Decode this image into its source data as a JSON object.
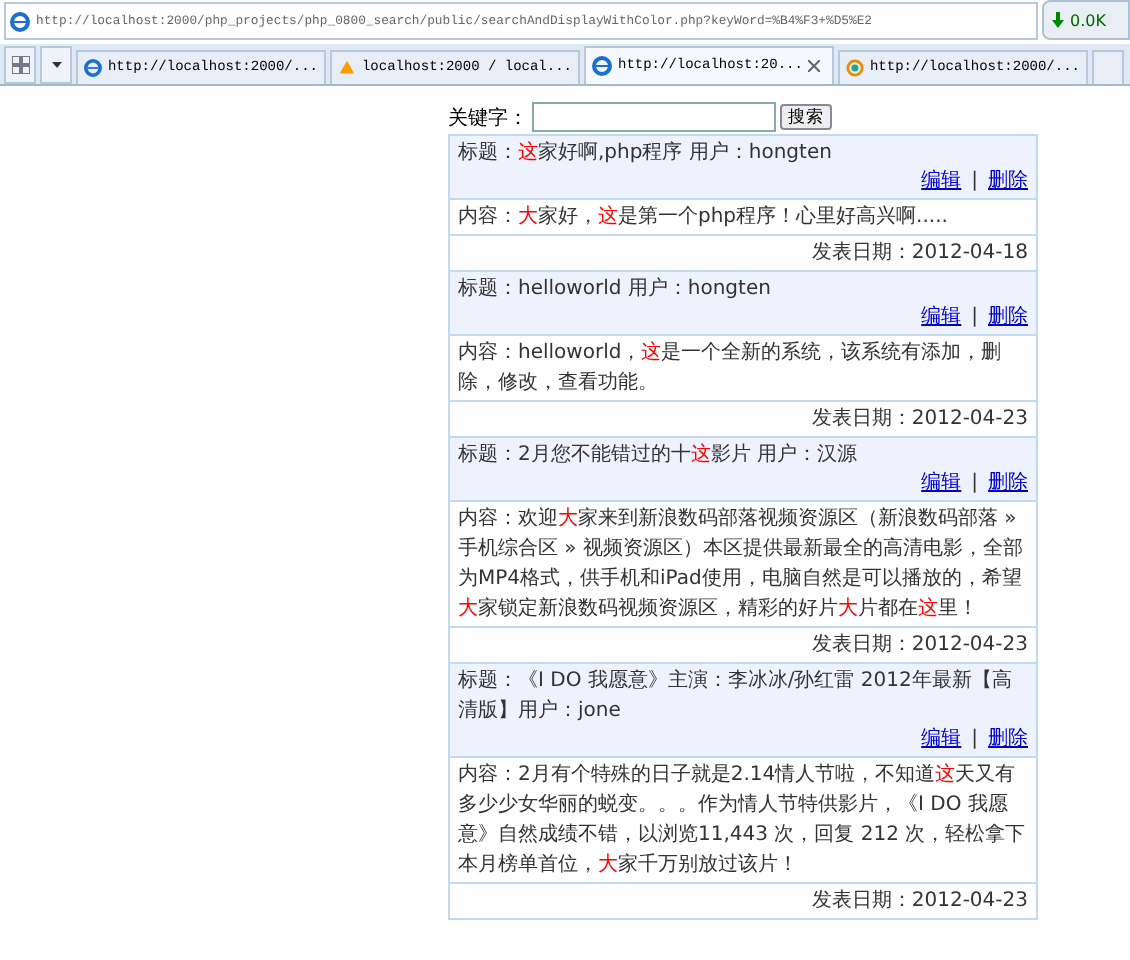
{
  "address_bar": {
    "url": "http://localhost:2000/php_projects/php_0800_search/public/searchAndDisplayWithColor.php?keyWord=%B4%F3+%D5%E2"
  },
  "net_widget": {
    "reading": "0.0K"
  },
  "tabs": [
    {
      "label": "http://localhost:2000/...",
      "selected": false
    },
    {
      "label": "localhost:2000 / local...",
      "selected": false
    },
    {
      "label": "http://localhost:20...",
      "selected": true
    },
    {
      "label": "http://localhost:2000/...",
      "selected": false
    }
  ],
  "search": {
    "label": "关键字：",
    "button": "搜索"
  },
  "posts": [
    {
      "title": "标题：**这**家好啊,php程序 用户：hongten",
      "edit": "编辑",
      "separator": "|",
      "delete": "删除",
      "content": "内容：**大**家好，**这**是第一个php程序！心里好高兴啊.....",
      "date": "发表日期：2012-04-18"
    },
    {
      "title": "标题：helloworld 用户：hongten",
      "edit": "编辑",
      "separator": "|",
      "delete": "删除",
      "content": "内容：helloworld，**这**是一个全新的系统，该系统有添加，删除，修改，查看功能。",
      "date": "发表日期：2012-04-23"
    },
    {
      "title": "标题：2月您不能错过的十**这**影片 用户：汉源",
      "edit": "编辑",
      "separator": "|",
      "delete": "删除",
      "content": "内容：欢迎**大**家来到新浪数码部落视频资源区（新浪数码部落 » 手机综合区 » 视频资源区）本区提供最新最全的高清电影，全部为MP4格式，供手机和iPad使用，电脑自然是可以播放的，希望**大**家锁定新浪数码视频资源区，精彩的好片**大**片都在**这**里！",
      "date": "发表日期：2012-04-23"
    },
    {
      "title": "标题：《I DO 我愿意》主演：李冰冰/孙红雷 2012年最新【高清版】用户：jone",
      "edit": "编辑",
      "separator": "|",
      "delete": "删除",
      "content": "内容：2月有个特殊的日子就是2.14情人节啦，不知道**这**天又有多少少女华丽的蜕变。。。作为情人节特供影片，《I DO 我愿意》自然成绩不错，以浏览11,443 次，回复 212 次，轻松拿下本月榜单首位，**大**家千万别放过该片！",
      "date": "发表日期：2012-04-23"
    }
  ]
}
